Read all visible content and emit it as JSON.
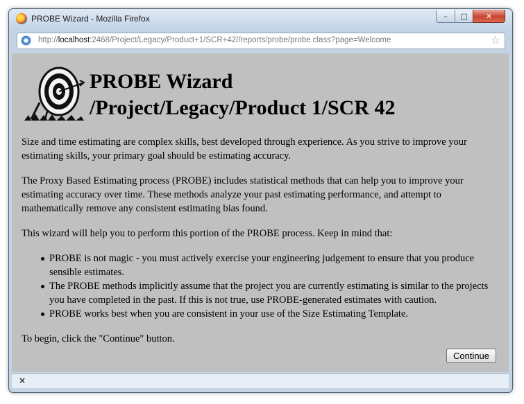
{
  "window": {
    "title": "PROBE Wizard - Mozilla Firefox",
    "buttons": {
      "minimize": "–",
      "maximize": "□",
      "close": "✕"
    },
    "app_icon": "firefox-icon"
  },
  "address_bar": {
    "url_prefix": "http://",
    "url_host": "localhost",
    "url_rest": ":2468/Project/Legacy/Product+1/SCR+42//reports/probe/probe.class?page=Welcome",
    "site_icon": "page-icon",
    "bookmark_icon": "☆"
  },
  "page": {
    "title_line1": "PROBE Wizard",
    "title_line2": "/Project/Legacy/Product 1/SCR 42",
    "logo": "target-icon",
    "para1": "Size and time estimating are complex skills, best developed through experience. As you strive to improve your estimating skills, your primary goal should be estimating accuracy.",
    "para2": "The Proxy Based Estimating process (PROBE) includes statistical methods that can help you to improve your estimating accuracy over time. These methods analyze your past estimating performance, and attempt to mathematically remove any consistent estimating bias found.",
    "para3": "This wizard will help you to perform this portion of the PROBE process. Keep in mind that:",
    "bullets": [
      "PROBE is not magic - you must actively exercise your engineering judgement to ensure that you produce sensible estimates.",
      "The PROBE methods implicitly assume that the project you are currently estimating is similar to the projects you have completed in the past. If this is not true, use PROBE-generated estimates with caution.",
      "PROBE works best when you are consistent in your use of the Size Estimating Template."
    ],
    "para4": "To begin, click the \"Continue\" button.",
    "continue_label": "Continue"
  },
  "status_bar": {
    "close_glyph": "×"
  }
}
